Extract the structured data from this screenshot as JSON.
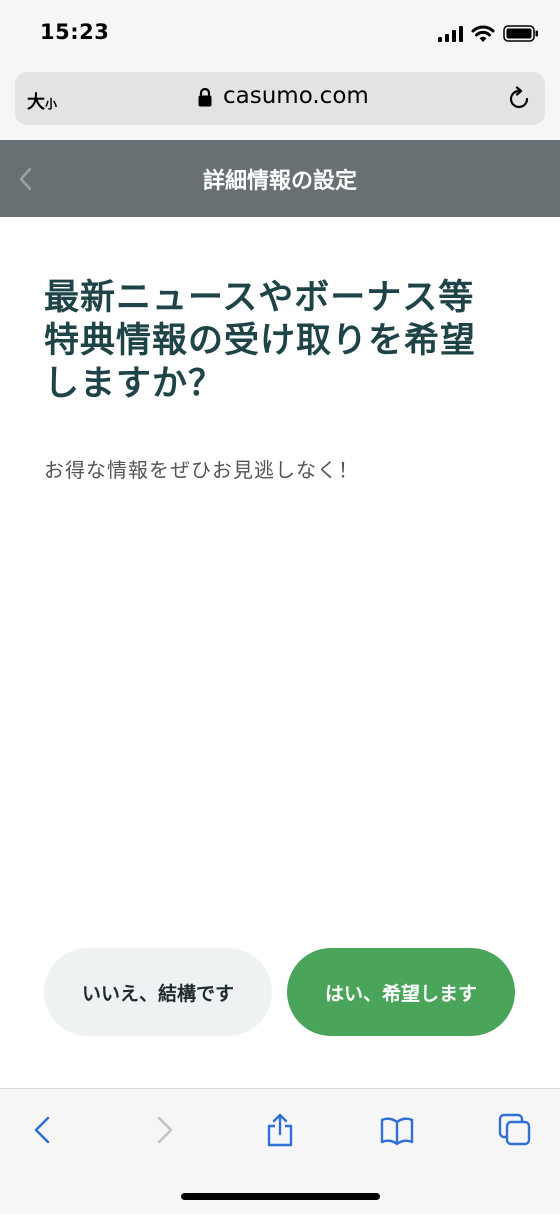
{
  "status_bar": {
    "time": "15:23"
  },
  "browser": {
    "text_size_label_large": "大",
    "text_size_label_small": "小",
    "url": "casumo.com"
  },
  "header": {
    "title": "詳細情報の設定"
  },
  "content": {
    "headline_lines": [
      "最新ニュースやボーナス等",
      "特典情報の受け取りを希望",
      "しますか？"
    ],
    "subtext": "お得な情報をぜひお見逃しなく！"
  },
  "buttons": {
    "decline_label": "いいえ、結構です",
    "accept_label": "はい、希望します"
  },
  "colors": {
    "header_bg": "#687073",
    "headline": "#1f4448",
    "accept_button": "#4aa55a",
    "decline_button": "#eef2f2",
    "toolbar_icon": "#2f6fd6"
  },
  "icons": [
    "signal-icon",
    "wifi-icon",
    "battery-icon",
    "lock-icon",
    "reload-icon",
    "back-chevron-icon",
    "nav-back-icon",
    "nav-forward-icon",
    "share-icon",
    "bookmarks-icon",
    "tabs-icon"
  ]
}
